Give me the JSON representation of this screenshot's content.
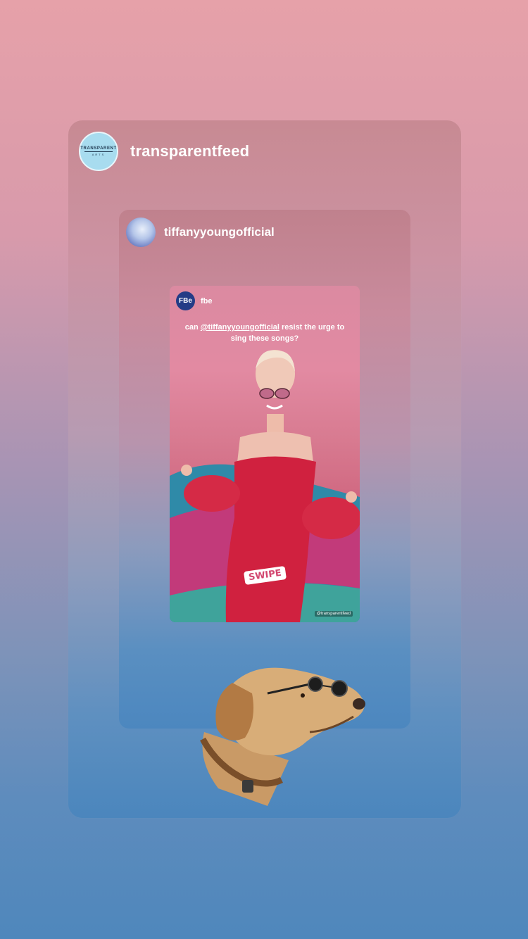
{
  "outer_post": {
    "username": "transparentfeed",
    "avatar_logo_top": "TRANSPARENT",
    "avatar_logo_bottom": "ARTS"
  },
  "shared_post": {
    "username": "tiffanyyoungofficial"
  },
  "story": {
    "account_badge": "FBe",
    "account_name": "fbe",
    "caption_prefix": "can ",
    "caption_mention": "@tiffanyyoungofficial",
    "caption_suffix": " resist the urge to sing these songs?",
    "sticker_text": "SWIPE",
    "watermark": "@transparentfeed"
  },
  "colors": {
    "background_top": "#e6a1a9",
    "background_bottom": "#4f87bc",
    "dress": "#d0213f"
  },
  "icons": {
    "outer_avatar": "transparent-arts-logo",
    "inner_avatar": "profile-photo",
    "sticker": "sunglasses-dog-sticker"
  }
}
